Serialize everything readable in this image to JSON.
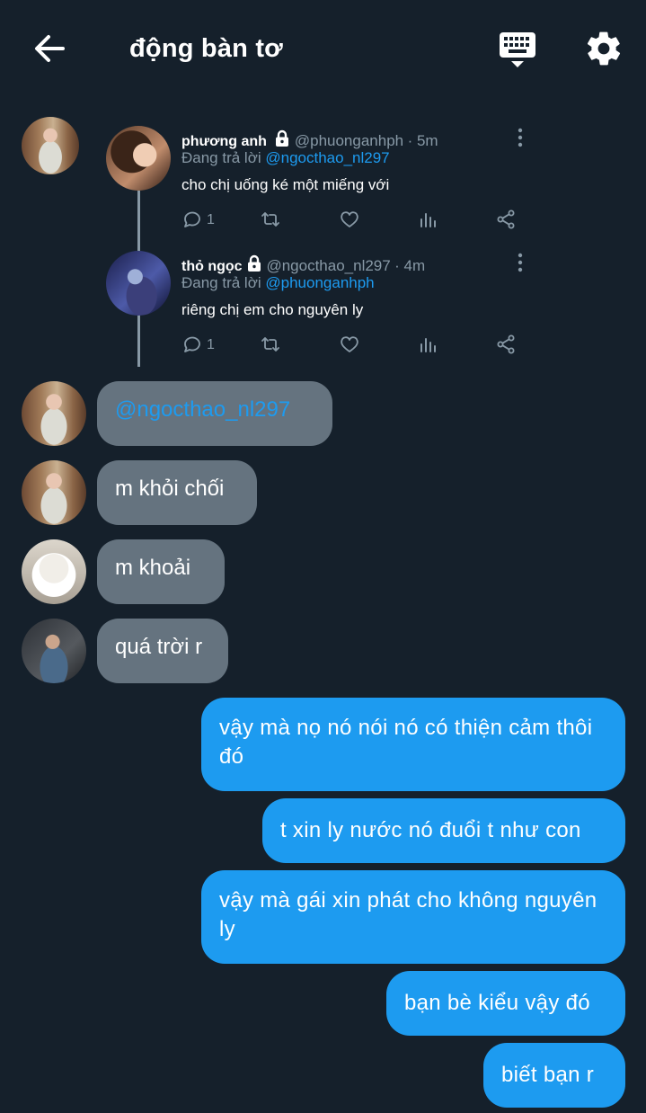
{
  "header": {
    "title": "động bàn tơ",
    "back_icon": "back-arrow-icon",
    "keyboard_icon": "keyboard-icon",
    "settings_icon": "gear-icon"
  },
  "thread": {
    "tweets": [
      {
        "name": "phương anh",
        "handle": "@phuonganhph",
        "time": "· 5m",
        "reply_prefix": "Đang trả lời",
        "reply_to": "@ngocthao_nl297",
        "text": "cho chị uống ké một miếng với",
        "reply_count": "1"
      },
      {
        "name": "thỏ ngọc",
        "handle": "@ngocthao_nl297",
        "time": "· 4m",
        "reply_prefix": "Đang trả lời",
        "reply_to": "@phuonganhph",
        "text": "riêng chị em cho nguyên ly",
        "reply_count": "1"
      }
    ]
  },
  "messages_in": [
    {
      "text": "@ngocthao_nl297"
    },
    {
      "text": "m khỏi chối"
    },
    {
      "text": "m khoải"
    },
    {
      "text": "quá trời r"
    }
  ],
  "messages_out": [
    {
      "text": "vậy mà nọ nó nói nó có thiện cảm thôi đó"
    },
    {
      "text": "t xin ly nước nó đuổi t như con"
    },
    {
      "text": "vậy mà gái xin phát cho không nguyên ly"
    },
    {
      "text": "bạn bè kiểu vậy đó"
    },
    {
      "text": "biết bạn r"
    }
  ],
  "colors": {
    "background": "#15202b",
    "incoming_bubble": "#65737f",
    "outgoing_bubble": "#1d9bf0",
    "mention": "#1d9bf0",
    "muted": "#8899a6"
  }
}
